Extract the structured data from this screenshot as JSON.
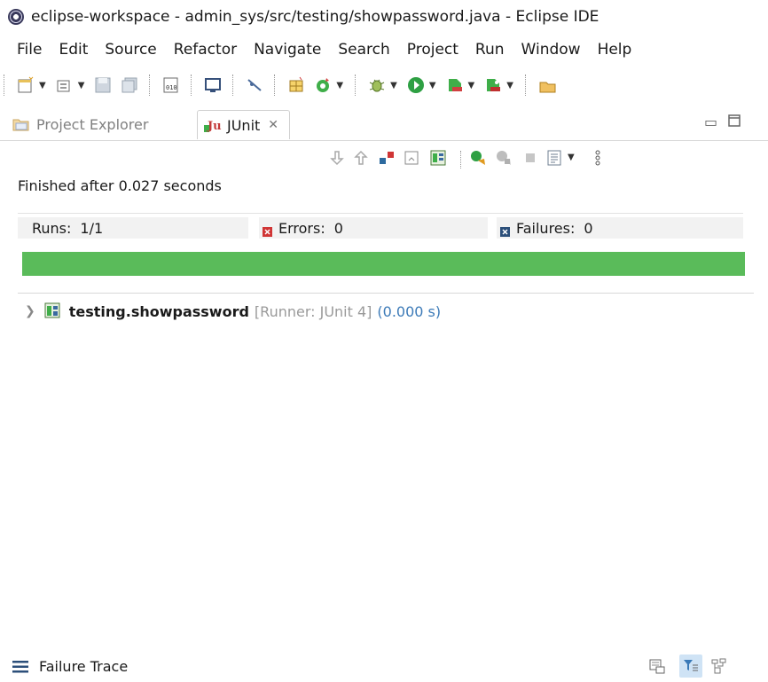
{
  "window": {
    "title": "eclipse-workspace - admin_sys/src/testing/showpassword.java - Eclipse IDE"
  },
  "menu": [
    "File",
    "Edit",
    "Source",
    "Refactor",
    "Navigate",
    "Search",
    "Project",
    "Run",
    "Window",
    "Help"
  ],
  "tabs": {
    "project_explorer": "Project Explorer",
    "junit": "JUnit"
  },
  "status": "Finished after 0.027 seconds",
  "counters": {
    "runs_label": "Runs:",
    "runs_value": "1/1",
    "errors_label": "Errors:",
    "errors_value": "0",
    "failures_label": "Failures:",
    "failures_value": "0"
  },
  "progress": {
    "fraction": 1.0,
    "color": "#5abb5a"
  },
  "tree": {
    "suite": "testing.showpassword",
    "runner": "[Runner: JUnit 4]",
    "time": "(0.000 s)"
  },
  "footer": {
    "label": "Failure Trace"
  },
  "icons": {
    "toolbar": [
      "new-wizard-icon",
      "new-package-icon",
      "save-icon",
      "save-all-icon",
      "open-type-icon",
      "console-icon",
      "toggle-breakpoint-icon",
      "new-class-icon",
      "refresh-icon",
      "debug-icon",
      "run-icon",
      "external-tools-icon",
      "coverage-icon",
      "perspective-icon"
    ],
    "view": [
      "next-failure-icon",
      "previous-failure-icon",
      "show-failures-only-icon",
      "scroll-lock-icon",
      "layout-icon",
      "rerun-test-icon",
      "rerun-failed-first-icon",
      "stop-icon",
      "history-icon",
      "view-menu-icon"
    ]
  }
}
